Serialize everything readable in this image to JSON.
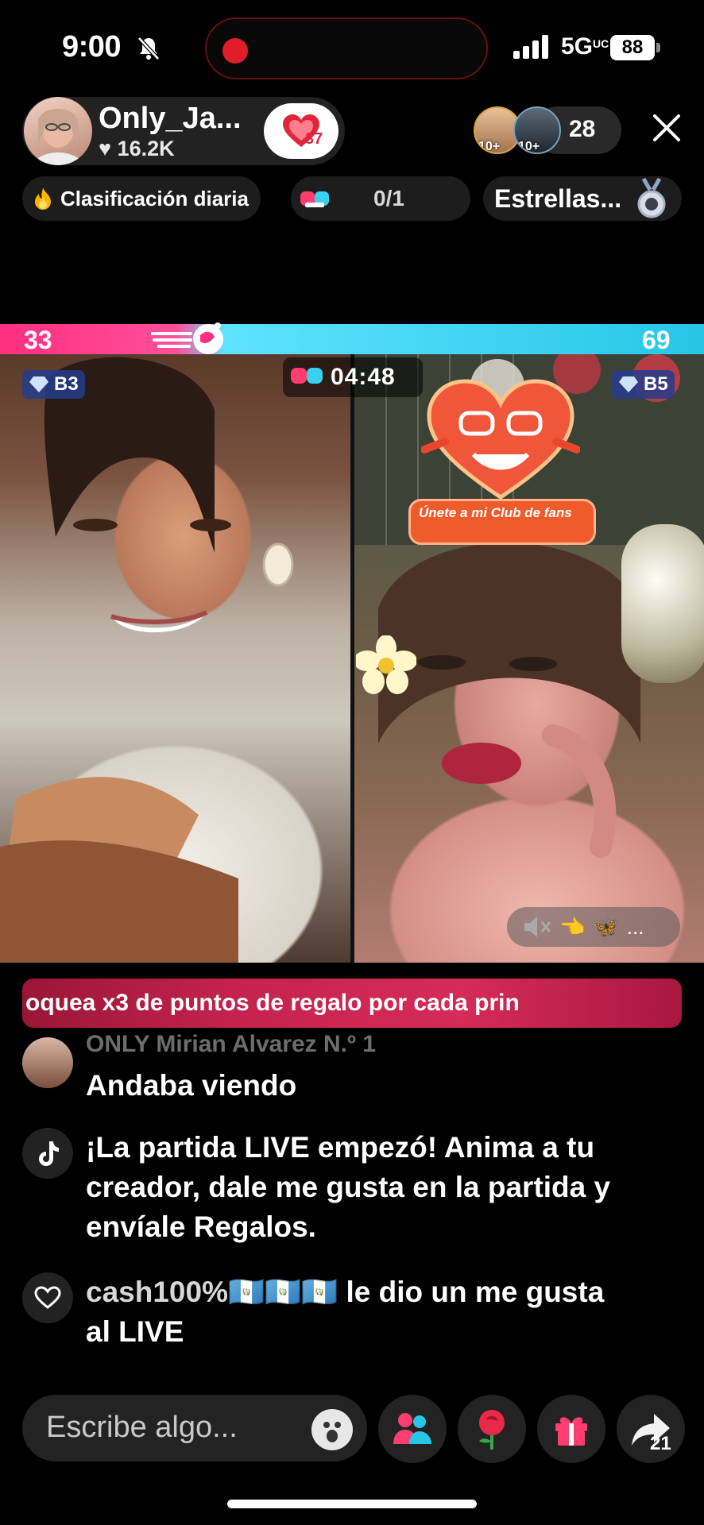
{
  "status_bar": {
    "time": "9:00",
    "network": "5G",
    "network_sub": "UC",
    "battery": "88"
  },
  "host": {
    "name": "Only_Ja...",
    "likes": "16.2K",
    "badge_level": "37"
  },
  "viewers": {
    "badge_1": "10+",
    "badge_2": "10+",
    "count": "28"
  },
  "pills": {
    "ranking": "Clasificación diaria",
    "stat": "0/1",
    "stars": "Estrellas..."
  },
  "battle": {
    "score_left": "33",
    "score_right": "69",
    "timer": "04:48",
    "level_left": "B3",
    "level_right": "B5"
  },
  "fan_club": {
    "label": "Únete a mi Club de fans"
  },
  "right_controls": {
    "dots": "..."
  },
  "promo": {
    "text": "oquea x3 de puntos de regalo por cada prin"
  },
  "comments": [
    {
      "user": "ONLY  Mirian Alvarez  N.º 1",
      "text": "Andaba viendo"
    },
    {
      "user": "",
      "text": "¡La partida LIVE empezó! Anima a tu creador, dale me gusta en la partida y envíale Regalos."
    },
    {
      "user": "cash100%🇬🇹🇬🇹🇬🇹",
      "text": " le dio un me gusta al LIVE"
    }
  ],
  "input": {
    "placeholder": "Escribe algo..."
  },
  "share": {
    "count": "21"
  },
  "colors": {
    "battle_pink": "#ff2f7f",
    "battle_cyan": "#27c6e6",
    "promo_red": "#c5234e"
  }
}
